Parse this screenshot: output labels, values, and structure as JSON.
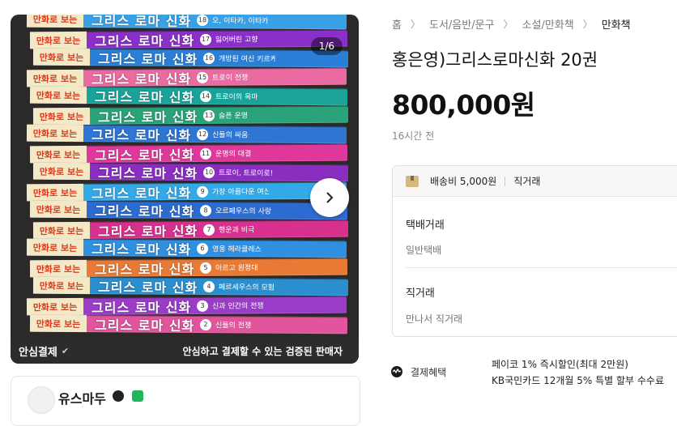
{
  "gallery": {
    "counter": "1/6",
    "next_icon": "chevron-right-icon",
    "trust_left": "안심결제",
    "trust_right": "안심하고 결제할 수 있는 검증된 판매자",
    "books": [
      {
        "head": "만화로 보는",
        "title": "그리스 로마 신화",
        "color": "#3aa0e6",
        "num": "18",
        "sub": "오, 이타카, 이타카!"
      },
      {
        "head": "만화로 보는",
        "title": "그리스 로마 신화",
        "color": "#8b2fc9",
        "num": "17",
        "sub": "잃어버린 고향"
      },
      {
        "head": "만화로 보는",
        "title": "그리스 로마 신화",
        "color": "#2b7fd6",
        "num": "16",
        "sub": "개방된 여신 키르케"
      },
      {
        "head": "만화로 보는",
        "title": "그리스 로마 신화",
        "color": "#ea6aa2",
        "num": "15",
        "sub": "트로이 전쟁"
      },
      {
        "head": "만화로 보는",
        "title": "그리스 로마 신화",
        "color": "#1aa39a",
        "num": "14",
        "sub": "트로이의 목마"
      },
      {
        "head": "만화로 보는",
        "title": "그리스 로마 신화",
        "color": "#2aa37a",
        "num": "13",
        "sub": "슬픈 운명"
      },
      {
        "head": "만화로 보는",
        "title": "그리스 로마 신화",
        "color": "#2f75d2",
        "num": "12",
        "sub": "신들의 싸움"
      },
      {
        "head": "만화로 보는",
        "title": "그리스 로마 신화",
        "color": "#e0389a",
        "num": "11",
        "sub": "운명의 대결"
      },
      {
        "head": "만화로 보는",
        "title": "그리스 로마 신화",
        "color": "#8a2ec0",
        "num": "10",
        "sub": "트로이, 트로이로!"
      },
      {
        "head": "만화로 보는",
        "title": "그리스 로마 신화",
        "color": "#34a9e8",
        "num": "9",
        "sub": "가장 아름다운 여신"
      },
      {
        "head": "만화로 보는",
        "title": "그리스 로마 신화",
        "color": "#2c6cd0",
        "num": "8",
        "sub": "오르페우스의 사랑"
      },
      {
        "head": "만화로 보는",
        "title": "그리스 로마 신화",
        "color": "#d8308e",
        "num": "7",
        "sub": "행운과 비극"
      },
      {
        "head": "만화로 보는",
        "title": "그리스 로마 신화",
        "color": "#2f8fe0",
        "num": "6",
        "sub": "영웅 헤라클레스"
      },
      {
        "head": "만화로 보는",
        "title": "그리스 로마 신화",
        "color": "#e87a36",
        "num": "5",
        "sub": "아르고 원정대"
      },
      {
        "head": "만화로 보는",
        "title": "그리스 로마 신화",
        "color": "#2b8fcf",
        "num": "4",
        "sub": "페르세우스의 모험"
      },
      {
        "head": "만화로 보는",
        "title": "그리스 로마 신화",
        "color": "#9b3cc9",
        "num": "3",
        "sub": "신과 인간의 전쟁"
      },
      {
        "head": "만화로 보는",
        "title": "그리스 로마 신화",
        "color": "#e0559c",
        "num": "2",
        "sub": "신들의 전쟁"
      }
    ]
  },
  "seller": {
    "name": "유스마두"
  },
  "breadcrumb": [
    "홈",
    "도서/음반/문구",
    "소설/만화책",
    "만화책"
  ],
  "product": {
    "title": "홍은영)그리스로마신화 20권",
    "price": "800,000원",
    "time": "16시간 전"
  },
  "shipping": {
    "fee": "배송비 5,000원",
    "method": "직거래",
    "delivery_label": "택배거래",
    "delivery_value": "일반택배",
    "direct_label": "직거래",
    "direct_value": "만나서 직거래"
  },
  "payment": {
    "label": "결제혜택",
    "line1": "페이코 1% 즉시할인(최대 2만원)",
    "line2": "KB국민카드 12개월 5% 특별 할부 수수료"
  }
}
